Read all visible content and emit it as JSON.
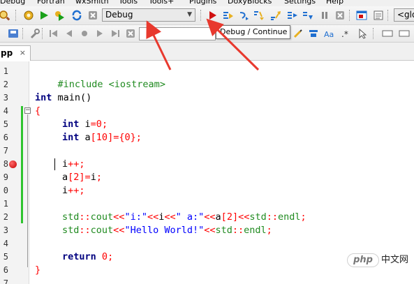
{
  "menu": [
    "Debug",
    "Fortran",
    "wxSmith",
    "Tools",
    "Tools+",
    "Plugins",
    "DoxyBlocks",
    "Settings",
    "Help"
  ],
  "toolbar": {
    "build_target": "Debug",
    "symbol_combo": "<glo",
    "search_placeholder": ""
  },
  "tooltip": {
    "text": "Debug / Continue"
  },
  "tab": {
    "label": "pp",
    "close": "×"
  },
  "line_numbers": [
    "1",
    "2",
    "3",
    "4",
    "5",
    "6",
    "7",
    "8",
    "9",
    "0",
    "1",
    "2",
    "3",
    "4",
    "5",
    "6",
    "7"
  ],
  "code": {
    "l1": "#include <iostream>",
    "l3_kw": "int",
    "l3_rest": " main()",
    "l4": "{",
    "l5_kw": "int",
    "l5_a": " i",
    "l5_b": "=",
    "l5_c": "0",
    "l5_d": ";",
    "l6_kw": "int",
    "l6_a": " a",
    "l6_b": "[",
    "l6_c": "10",
    "l6_d": "]={",
    "l6_e": "0",
    "l6_f": "};",
    "l8_a": "i",
    "l8_b": "++;",
    "l9_a": "a",
    "l9_b": "[",
    "l9_c": "2",
    "l9_d": "]=",
    "l9_e": "i",
    "l9_f": ";",
    "l10_a": "i",
    "l10_b": "++;",
    "l12_a": "std",
    "l12_b": "::",
    "l12_c": "cout",
    "l12_d": "<<",
    "l12_e": "\"i:\"",
    "l12_f": "<<",
    "l12_g": "i",
    "l12_h": "<<",
    "l12_i": "\" a:\"",
    "l12_j": "<<",
    "l12_k": "a",
    "l12_l": "[",
    "l12_m": "2",
    "l12_n": "]<<",
    "l12_o": "std",
    "l12_p": "::",
    "l12_q": "endl",
    "l12_r": ";",
    "l13_a": "std",
    "l13_b": "::",
    "l13_c": "cout",
    "l13_d": "<<",
    "l13_e": "\"Hello World!\"",
    "l13_f": "<<",
    "l13_g": "std",
    "l13_h": "::",
    "l13_i": "endl",
    "l13_j": ";",
    "l15_kw": "return",
    "l15_a": " ",
    "l15_b": "0",
    "l15_c": ";",
    "l16": "}"
  },
  "watermark": {
    "logo": "php",
    "text": "中文网"
  },
  "colors": {
    "breakpoint": "#c40000",
    "annotation_arrow": "#e8392e",
    "change_bar": "#2ec42e"
  }
}
